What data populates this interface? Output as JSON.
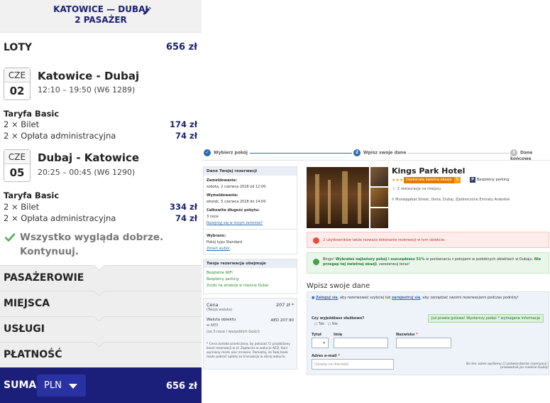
{
  "left": {
    "route_header": {
      "route": "KATOWICE — DUBAJ",
      "passengers": "2 PASAŻER"
    },
    "flights_title": "LOTY",
    "flights_total": "656 zł",
    "flights": [
      {
        "dow": "CZE",
        "day": "02",
        "route": "Katowice - Dubaj",
        "time": "12:10 – 19:50 (W6 1289)",
        "fare_title": "Taryfa Basic",
        "lines": [
          {
            "label": "2 × Bilet",
            "amount": "174 zł"
          },
          {
            "label": "2 × Opłata administracyjna",
            "amount": "74 zł"
          }
        ]
      },
      {
        "dow": "CZE",
        "day": "05",
        "route": "Dubaj - Katowice",
        "time": "20:25 – 00:45 (W6 1290)",
        "fare_title": "Taryfa Basic",
        "lines": [
          {
            "label": "2 × Bilet",
            "amount": "334 zł"
          },
          {
            "label": "2 × Opłata administracyjna",
            "amount": "74 zł"
          }
        ]
      }
    ],
    "ok_message_1": "Wszystko wygląda dobrze.",
    "ok_message_2": "Kontynuuj.",
    "accordion": [
      "PASAŻEROWIE",
      "MIEJSCA",
      "USŁUGI",
      "PŁATNOŚĆ"
    ],
    "sum": {
      "label": "SUMA",
      "currency": "PLN",
      "amount": "656 zł"
    },
    "colors": {
      "brand": "#1b1f7a",
      "price": "#1b1f6e",
      "ok": "#4caf50"
    }
  },
  "right": {
    "steps": [
      {
        "num": "✓",
        "label": "Wybierz pokój"
      },
      {
        "num": "2",
        "label": "Wpisz swoje dane"
      },
      {
        "num": "3",
        "label": "Dane końcowe"
      }
    ],
    "reservation": {
      "header": "Dane Twojej rezerwacji",
      "checkin_label": "Zameldowanie:",
      "checkin_value": "sobota, 2 czerwca 2018 od 12:00",
      "checkout_label": "Wymeldowanie:",
      "checkout_value": "wtorek, 5 czerwca 2018 do 14:00",
      "length_label": "Całkowita długość pobytu:",
      "length_value": "3 noce",
      "change_link": "Rozejrzyj się w innym terminie?",
      "chosen_label": "Wybrano:",
      "chosen_value": "Pokój typu Standard",
      "change_choice": "Zmień wybór"
    },
    "includes": {
      "header": "Twoja rezerwacja obejmuje",
      "items": [
        "Bezpłatne WiFi",
        "Bezpłatny parking",
        "Zniżki na atrakcje w mieście Dubai"
      ]
    },
    "price": {
      "label": "Cena",
      "sub": "(Twoja waluta)",
      "value": "207 zł *",
      "obj_label": "Waluta obiektu",
      "obj_sub": "w AED",
      "obj_value": "AED 207.90",
      "nights": "(za 3 noce i wszystkich Gości)",
      "note": "* Cena została przeliczona, by pokazać Ci przybliżony koszt rezerwacji w zł. Zapłacisz w walucie AED. Kurs wymiany może ulec zmianie. Pamiętaj, że Twój bank może pobrać opłatę za transakcję w obcej walucie."
    },
    "hotel": {
      "name": "Kings Park Hotel",
      "stars": "★★★",
      "rating": "Doskonała świetna okazja",
      "count": "6",
      "parking": "Bezpłatny parking",
      "restaurants": "2 restauracje na miejscu",
      "address": "Muraqqabat Street, Deira, Dubaj, Zjednoczone Emiraty Arabskie"
    },
    "alert_red": "2 użytkowników także rozważa dokonanie rezerwacji w tym obiekcie.",
    "alert_green_prefix": "Bingo!",
    "alert_green_bold": "Wybrałeś najtańszy pokój i oszczędzasz 51%",
    "alert_green_text": "w porównaniu z pokojami w podobnych obiektach w Dubaju.",
    "alert_green_bold2": "Nie przegap tej świetnej okazji",
    "alert_green_tail": ", zarezerwuj teraz!",
    "form": {
      "title": "Wpisz swoje dane",
      "login_link": "Zaloguj się",
      "login_mid": ", aby rezerwować szybciej lub",
      "register_link": "zarejestruj się",
      "login_tail": ", aby zarządzać swoimi rezerwacjami podczas podróży!",
      "business_q": "Czy wyjeżdżasz służbowo?",
      "yes": "Tak",
      "no": "Nie",
      "hint": "Już prawie gotowe! Wystarczy podać * wymagane informacje",
      "title_label": "Tytuł",
      "name_label": "Imię",
      "surname_label": "Nazwisko",
      "email_label": "Adres e-mail",
      "email_placeholder": "Uważaj na literówki",
      "confirm_note": "Na ten adres wyślemy Ci potwierdzenie rezerwacji i przewodnik po mieście Dubaj!"
    }
  }
}
